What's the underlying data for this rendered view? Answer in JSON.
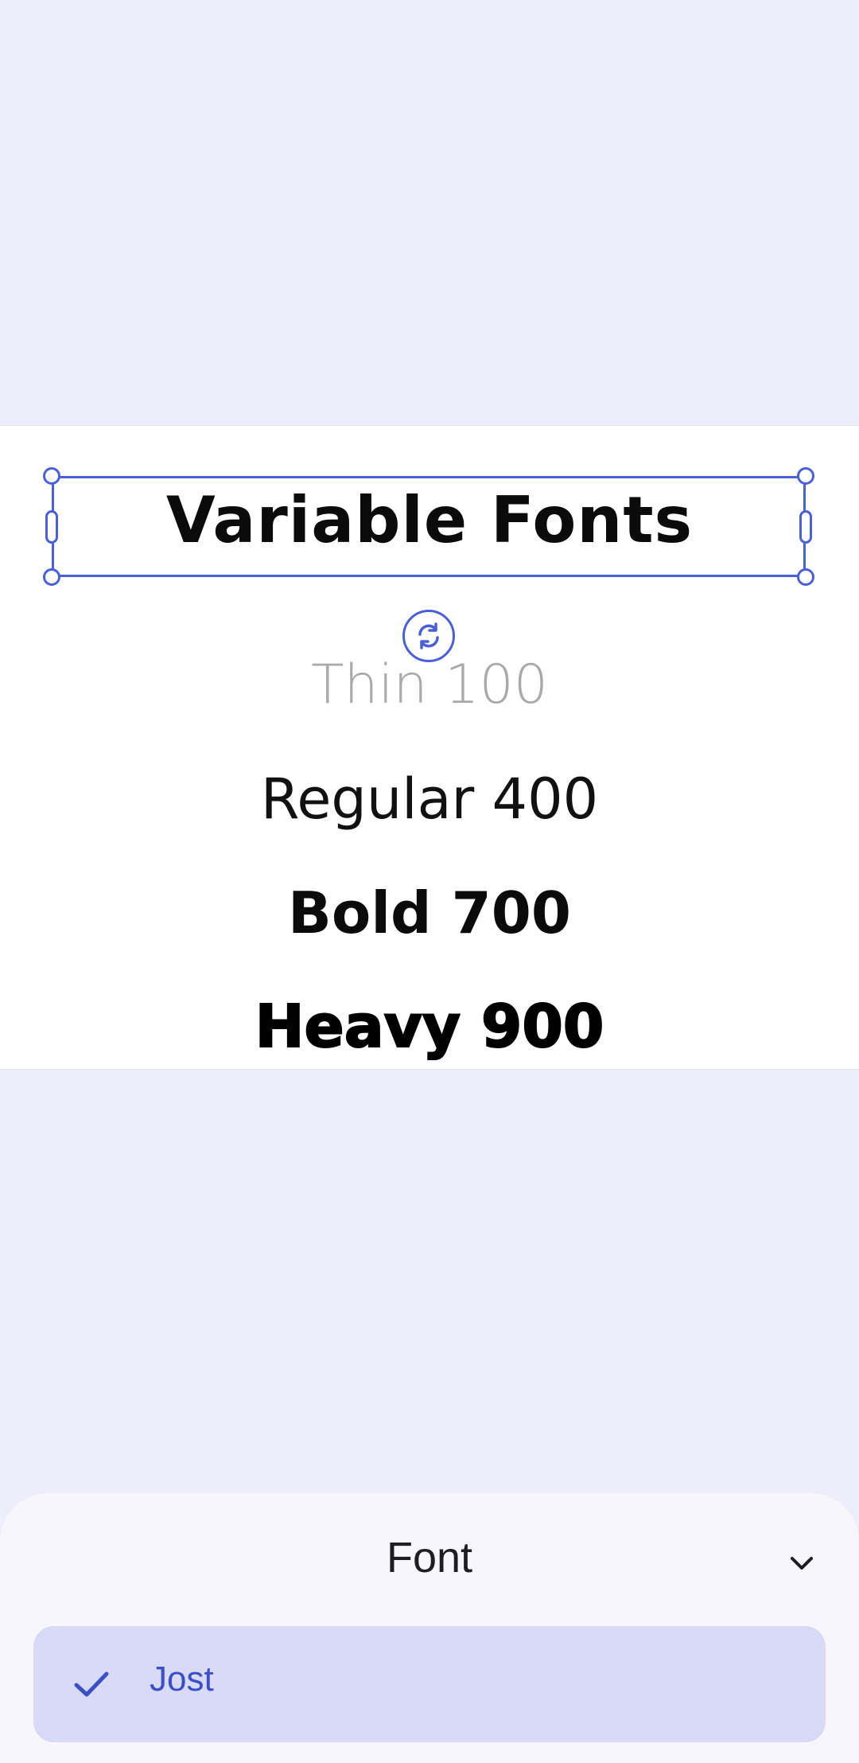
{
  "canvas": {
    "title_text": "Variable Fonts",
    "lines": {
      "thin": "Thin 100",
      "regular": "Regular 400",
      "bold": "Bold 700",
      "heavy": "Heavy 900"
    },
    "selection": {
      "rotate_icon": "rotate-icon"
    }
  },
  "sheet": {
    "title": "Font",
    "collapse_icon": "chevron-down-icon",
    "options": [
      {
        "label": "Jost",
        "selected": true,
        "icon": "check-icon"
      }
    ]
  },
  "colors": {
    "accent": "#4a5fd8",
    "background": "#ededfb",
    "selected_row": "#d8daf7"
  }
}
